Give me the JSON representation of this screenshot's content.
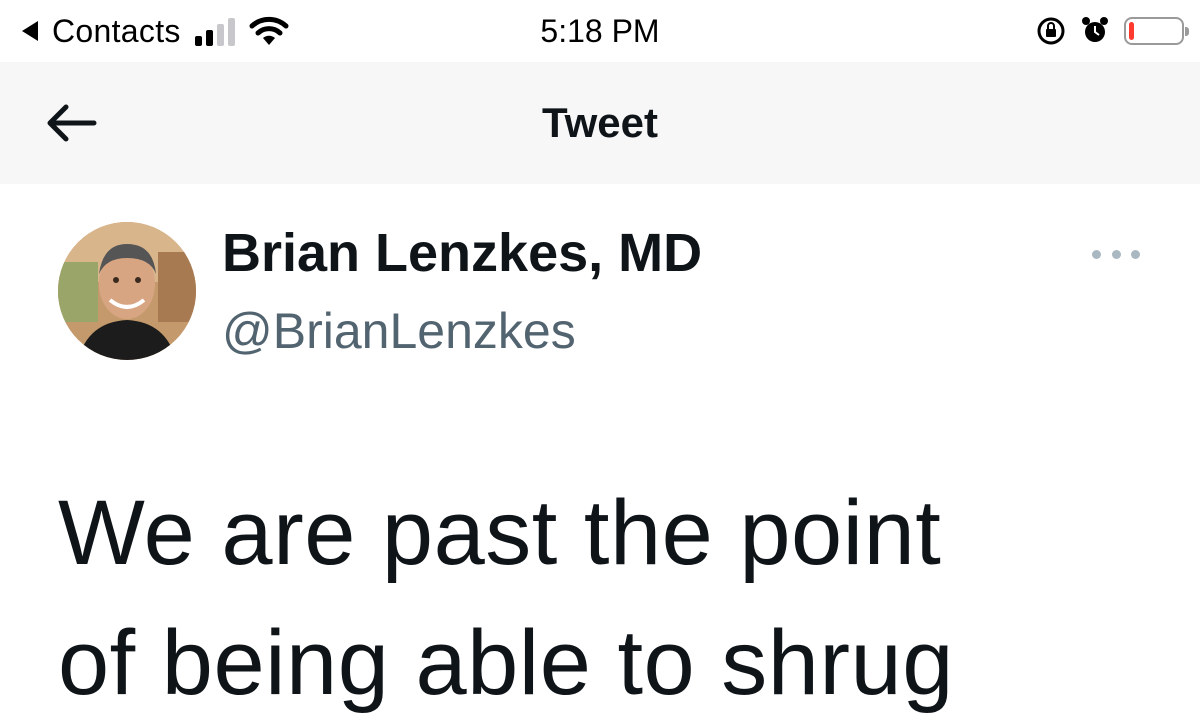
{
  "status_bar": {
    "back_app": "Contacts",
    "time": "5:18 PM",
    "signal_bars_active": 2,
    "signal_bars_total": 4,
    "battery_level": 0.1,
    "battery_color": "#ff3b30"
  },
  "header": {
    "title": "Tweet"
  },
  "tweet": {
    "author_name": "Brian Lenzkes, MD",
    "author_handle": "@BrianLenzkes",
    "text_line1": "We are past the point",
    "text_line2": "of being able to shrug"
  },
  "colors": {
    "text": "#0f1419",
    "secondary": "#536471",
    "header_bg": "#f7f7f7",
    "more_dots": "#aab8c2"
  },
  "icons": {
    "back": "arrow-left-icon",
    "more": "more-horizontal-icon",
    "wifi": "wifi-icon",
    "rotation_lock": "rotation-lock-icon",
    "alarm": "alarm-icon",
    "battery": "battery-icon"
  }
}
